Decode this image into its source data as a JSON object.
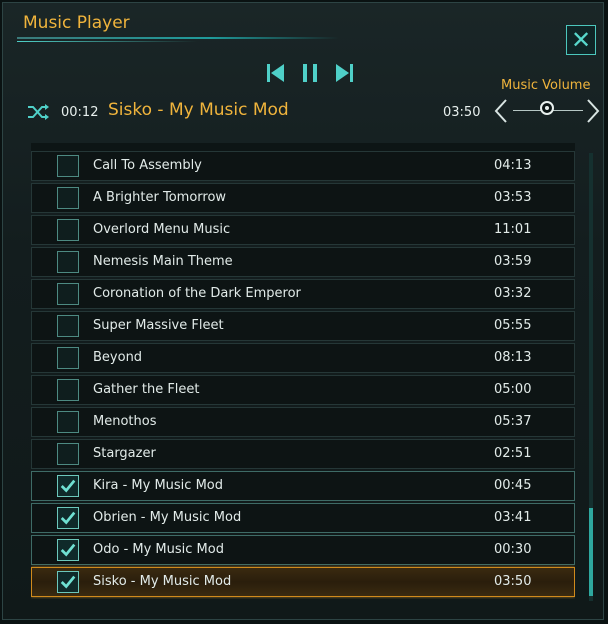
{
  "window": {
    "title": "Music Player",
    "close_label": "✕"
  },
  "player": {
    "elapsed": "00:12",
    "now_playing": "Sisko - My Music Mod",
    "total": "03:50",
    "volume_label": "Music Volume",
    "volume_level": 0.5
  },
  "tracks": [
    {
      "name": "Call To Assembly",
      "duration": "04:13",
      "checked": false,
      "active": false
    },
    {
      "name": "A Brighter Tomorrow",
      "duration": "03:53",
      "checked": false,
      "active": false
    },
    {
      "name": "Overlord Menu Music",
      "duration": "11:01",
      "checked": false,
      "active": false
    },
    {
      "name": "Nemesis Main Theme",
      "duration": "03:59",
      "checked": false,
      "active": false
    },
    {
      "name": "Coronation of the Dark Emperor",
      "duration": "03:32",
      "checked": false,
      "active": false
    },
    {
      "name": "Super Massive Fleet",
      "duration": "05:55",
      "checked": false,
      "active": false
    },
    {
      "name": "Beyond",
      "duration": "08:13",
      "checked": false,
      "active": false
    },
    {
      "name": "Gather the Fleet",
      "duration": "05:00",
      "checked": false,
      "active": false
    },
    {
      "name": "Menothos",
      "duration": "05:37",
      "checked": false,
      "active": false
    },
    {
      "name": "Stargazer",
      "duration": "02:51",
      "checked": false,
      "active": false
    },
    {
      "name": "Kira - My Music Mod",
      "duration": "00:45",
      "checked": true,
      "active": false
    },
    {
      "name": "Obrien - My Music Mod",
      "duration": "03:41",
      "checked": true,
      "active": false
    },
    {
      "name": "Odo - My Music Mod",
      "duration": "00:30",
      "checked": true,
      "active": false
    },
    {
      "name": "Sisko - My Music Mod",
      "duration": "03:50",
      "checked": true,
      "active": true
    }
  ],
  "colors": {
    "accent": "#f0b43c",
    "teal": "#4fd0c8"
  },
  "icons": {
    "prev": "skip-previous-icon",
    "pause": "pause-icon",
    "next": "skip-next-icon",
    "shuffle": "shuffle-icon",
    "close": "close-icon",
    "check": "checkmark-icon"
  }
}
